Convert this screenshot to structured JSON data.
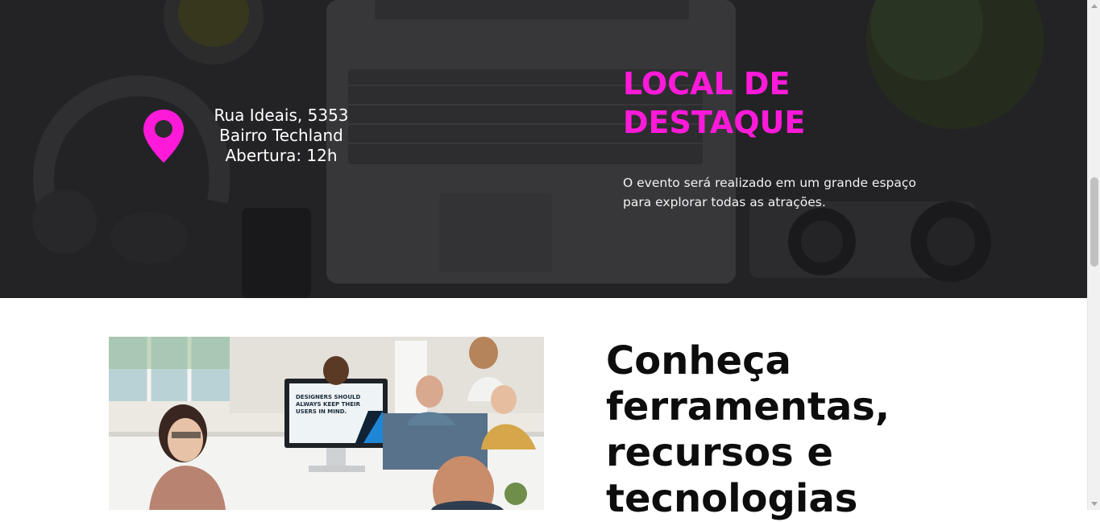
{
  "colors": {
    "accent": "#ff1ad9",
    "hero_text": "#ffffff",
    "heading_text": "#0d0d0d",
    "background": "#ffffff"
  },
  "location": {
    "pin_icon": "map-pin-icon",
    "address_line1": "Rua Ideais, 5353",
    "address_line2": "Bairro Techland",
    "address_line3": "Abertura: 12h",
    "title_line1": "LOCAL DE",
    "title_line2": "DESTAQUE",
    "description": "O evento será realizado em um grande espaço para explorar todas as atrações."
  },
  "tools": {
    "heading_line1": "Conheça",
    "heading_line2": "ferramentas,",
    "heading_line3": "recursos e",
    "heading_line4": "tecnologias",
    "photo_screen_text": "DESIGNERS SHOULD ALWAYS KEEP THEIR USERS IN MIND."
  }
}
